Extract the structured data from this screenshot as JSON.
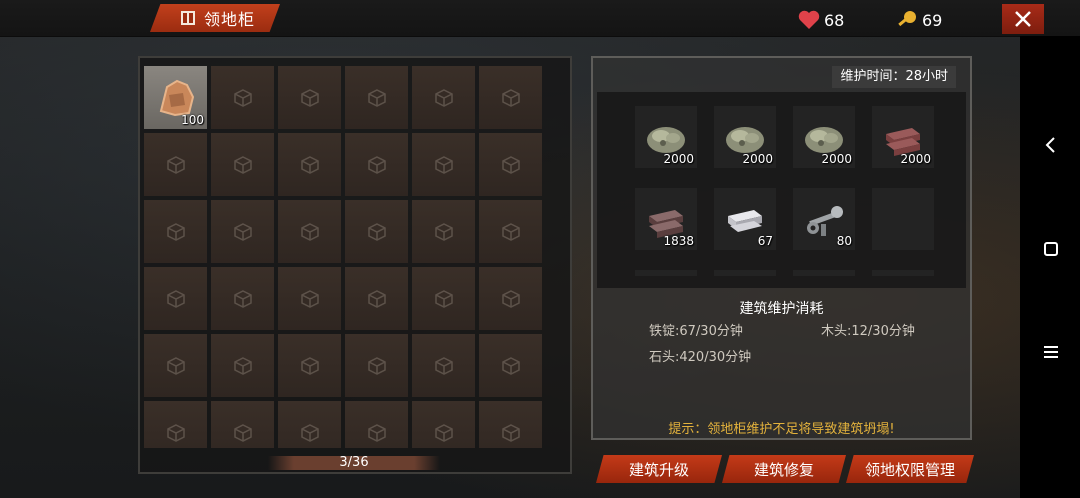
{
  "header": {
    "title": "领地柜",
    "hearts": "68",
    "keys": "69"
  },
  "inventory": {
    "slots": [
      {
        "qty": "100",
        "icon": "leather-hide-icon"
      }
    ],
    "count": "3/36"
  },
  "maintenance": {
    "time_label": "维护时间：28小时",
    "items": [
      {
        "icon": "stone-ore-icon",
        "qty": "2000"
      },
      {
        "icon": "stone-ore-icon",
        "qty": "2000"
      },
      {
        "icon": "stone-ore-icon",
        "qty": "2000"
      },
      {
        "icon": "copper-ingot-icon",
        "qty": "2000"
      },
      {
        "icon": "iron-ingot-icon",
        "qty": "1838"
      },
      {
        "icon": "silver-ingot-icon",
        "qty": "67"
      },
      {
        "icon": "wrench-parts-icon",
        "qty": "80"
      },
      {
        "icon": "empty-slot",
        "qty": ""
      }
    ],
    "heading": "建筑维护消耗",
    "iron_rate": "铁锭:67/30分钟",
    "wood_rate": "木头:12/30分钟",
    "stone_rate": "石头:420/30分钟",
    "tip": "提示：领地柜维护不足将导致建筑坍塌!"
  },
  "buttons": {
    "upgrade": "建筑升级",
    "repair": "建筑修复",
    "permission": "领地权限管理"
  },
  "colors": {
    "accent": "#c43a18",
    "tip": "#e3b23c"
  }
}
